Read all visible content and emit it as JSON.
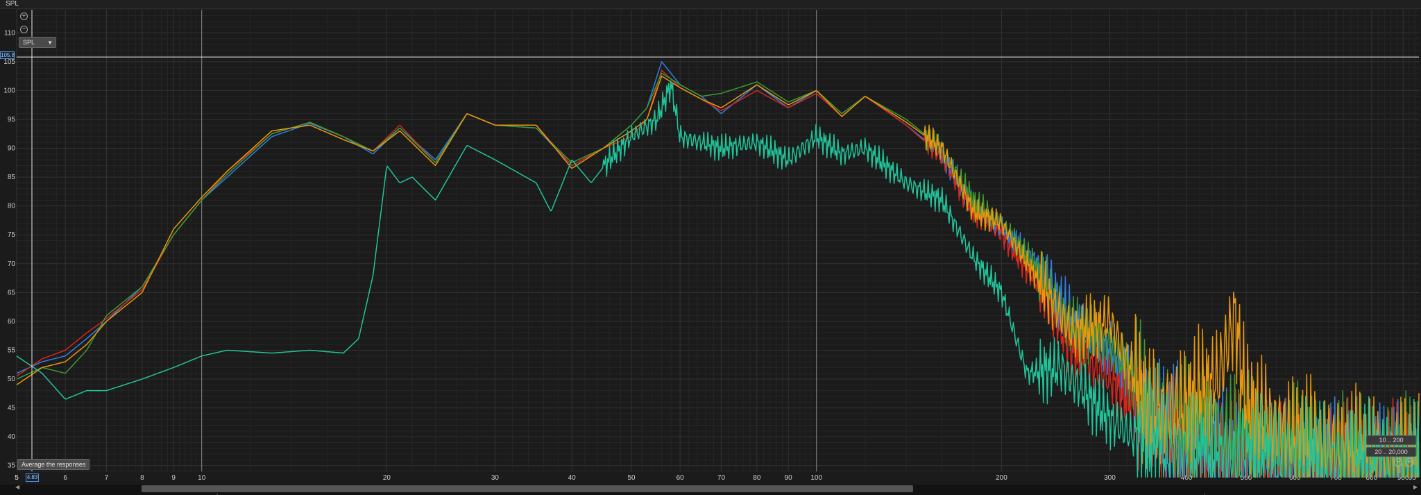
{
  "window": {
    "title": "SPL"
  },
  "controls": {
    "spl_select": "SPL",
    "cursor_y": "105.8",
    "cursor_x": "4.83",
    "tooltip": "Average the responses",
    "range_buttons": [
      "10 .. 200",
      "20 .. 20,000"
    ]
  },
  "icons": {
    "zoom_in": "zoom-in-icon",
    "zoom_out": "zoom-out-icon",
    "dropdown": "chevron-down-icon"
  },
  "colors": {
    "background": "#1b1b1b",
    "grid_major": "#333333",
    "grid_minor": "#262626",
    "cursor": "#e8e8e8",
    "series_blue": "#2f7fe8",
    "series_red": "#d8261d",
    "series_green": "#3c9a30",
    "series_orange": "#e8980c",
    "series_teal": "#20c49a"
  },
  "chart_data": {
    "type": "line",
    "title": "",
    "xlabel": "",
    "ylabel": "SPL",
    "x_scale": "log",
    "xlim": [
      5,
      955
    ],
    "ylim": [
      34,
      114
    ],
    "grid": true,
    "cursor": {
      "x": 4.83,
      "y": 105.8
    },
    "y_ticks": [
      35,
      40,
      45,
      50,
      55,
      60,
      65,
      70,
      75,
      80,
      85,
      90,
      95,
      100,
      105,
      110
    ],
    "y_tick_labels": [
      "35",
      "40",
      "45",
      "50",
      "55",
      "60",
      "65",
      "70",
      "75",
      "80",
      "85",
      "90",
      "95",
      "100",
      "105",
      "110"
    ],
    "x_ticks": [
      5,
      6,
      7,
      8,
      9,
      10,
      20,
      30,
      40,
      50,
      60,
      70,
      80,
      90,
      100,
      200,
      300,
      400,
      500,
      600,
      700,
      800,
      900
    ],
    "x_tick_labels": [
      "5",
      "6",
      "7",
      "8",
      "9",
      "10",
      "20",
      "30",
      "40",
      "50",
      "60",
      "70",
      "80",
      "90",
      "100",
      "200",
      "300",
      "400",
      "500",
      "600",
      "700",
      "800",
      "900"
    ],
    "x_edge_labels": [
      "5",
      "95"
    ],
    "series": [
      {
        "color": "#2f7fe8",
        "x": [
          5,
          5.5,
          6,
          6.5,
          7,
          8,
          9,
          10,
          11,
          13,
          15,
          17,
          19,
          21,
          24,
          27,
          30,
          35,
          40,
          45,
          50,
          53,
          56,
          60,
          65,
          70,
          80,
          90,
          100,
          110,
          120,
          140,
          160,
          180,
          200,
          230,
          260,
          300,
          350,
          400,
          450,
          500,
          600,
          700,
          800,
          955
        ],
        "y": [
          51,
          53,
          54,
          57,
          60,
          66,
          75,
          81,
          85,
          92,
          94.3,
          92,
          89,
          93.5,
          88,
          96,
          94,
          93.5,
          87,
          90,
          94,
          97,
          105,
          101,
          99,
          96,
          101,
          97,
          100,
          96,
          99,
          94,
          89,
          80,
          76,
          70,
          60,
          55,
          45,
          40,
          38,
          36,
          35,
          35,
          35,
          35
        ]
      },
      {
        "color": "#d8261d",
        "x": [
          5,
          5.5,
          6,
          6.5,
          7,
          8,
          9,
          10,
          11,
          13,
          15,
          17,
          19,
          21,
          24,
          27,
          30,
          35,
          40,
          45,
          50,
          53,
          56,
          60,
          65,
          70,
          80,
          90,
          100,
          110,
          120,
          140,
          160,
          180,
          200,
          230,
          260,
          300,
          350,
          400,
          450,
          500,
          600,
          700,
          800,
          955
        ],
        "y": [
          50.5,
          53.5,
          55,
          58,
          60.5,
          65.5,
          75,
          81,
          86,
          92.5,
          94.5,
          92,
          89.5,
          94,
          87.5,
          96,
          94,
          94,
          87,
          90,
          92,
          95,
          103.5,
          100.5,
          98.5,
          96.5,
          100,
          97,
          99.5,
          95.5,
          99,
          94,
          88.5,
          79,
          75,
          66,
          55,
          50,
          42,
          38,
          37,
          36,
          35,
          35,
          35,
          35
        ]
      },
      {
        "color": "#3c9a30",
        "x": [
          5,
          5.5,
          6,
          6.5,
          7,
          8,
          9,
          10,
          11,
          13,
          15,
          17,
          19,
          21,
          24,
          27,
          30,
          35,
          40,
          45,
          50,
          53,
          56,
          60,
          65,
          70,
          80,
          90,
          100,
          110,
          120,
          140,
          160,
          180,
          200,
          230,
          260,
          300,
          350,
          400,
          450,
          500,
          600,
          700,
          800,
          955
        ],
        "y": [
          50,
          52,
          51,
          55,
          61,
          66,
          75,
          81,
          85.5,
          92.5,
          94.5,
          92,
          89.5,
          93.5,
          87.5,
          96,
          94,
          93.5,
          87.5,
          90,
          94,
          97,
          103,
          101,
          99,
          99.5,
          101.5,
          98,
          100,
          96,
          99,
          95,
          90,
          81,
          77,
          69,
          59,
          56,
          46,
          42,
          41,
          40,
          38,
          37,
          36,
          36
        ]
      },
      {
        "color": "#e8980c",
        "x": [
          5,
          5.5,
          6,
          6.5,
          7,
          8,
          9,
          10,
          11,
          13,
          15,
          17,
          19,
          21,
          24,
          27,
          30,
          35,
          40,
          45,
          50,
          53,
          56,
          60,
          65,
          70,
          80,
          90,
          100,
          110,
          120,
          140,
          160,
          180,
          200,
          230,
          260,
          300,
          350,
          400,
          450,
          480,
          500,
          600,
          700,
          800,
          955
        ],
        "y": [
          49,
          52,
          53,
          56,
          60,
          65,
          76,
          81.5,
          86,
          93,
          94,
          91.5,
          89.5,
          93,
          87,
          96,
          94,
          94,
          86.5,
          90,
          93,
          95,
          102.5,
          100.5,
          98.5,
          97,
          101,
          97.5,
          100,
          95.5,
          99,
          94.5,
          90,
          79,
          77,
          67,
          58,
          60,
          44,
          46,
          50,
          61,
          45,
          40,
          38,
          37,
          36
        ]
      },
      {
        "color": "#20c49a",
        "x": [
          5,
          5.5,
          6,
          6.5,
          7,
          8,
          9,
          10,
          11,
          13,
          15,
          17,
          18,
          19,
          20,
          21,
          22,
          24,
          27,
          30,
          35,
          37,
          40,
          43,
          46,
          50,
          55,
          58,
          60,
          65,
          70,
          80,
          90,
          100,
          110,
          120,
          140,
          160,
          180,
          200,
          220,
          250,
          300,
          350,
          400,
          500,
          600,
          700,
          800,
          955
        ],
        "y": [
          54,
          51,
          46.5,
          48,
          48,
          50,
          52,
          54,
          55,
          54.5,
          55,
          54.5,
          57,
          68,
          87,
          84,
          85,
          81,
          90.5,
          88,
          84,
          79,
          88,
          84,
          88,
          92,
          95,
          101,
          92,
          91,
          90,
          91,
          88,
          92,
          89,
          90,
          84,
          81,
          71,
          65,
          51,
          52,
          43,
          38,
          37,
          36,
          36,
          35,
          35,
          35
        ]
      }
    ]
  }
}
